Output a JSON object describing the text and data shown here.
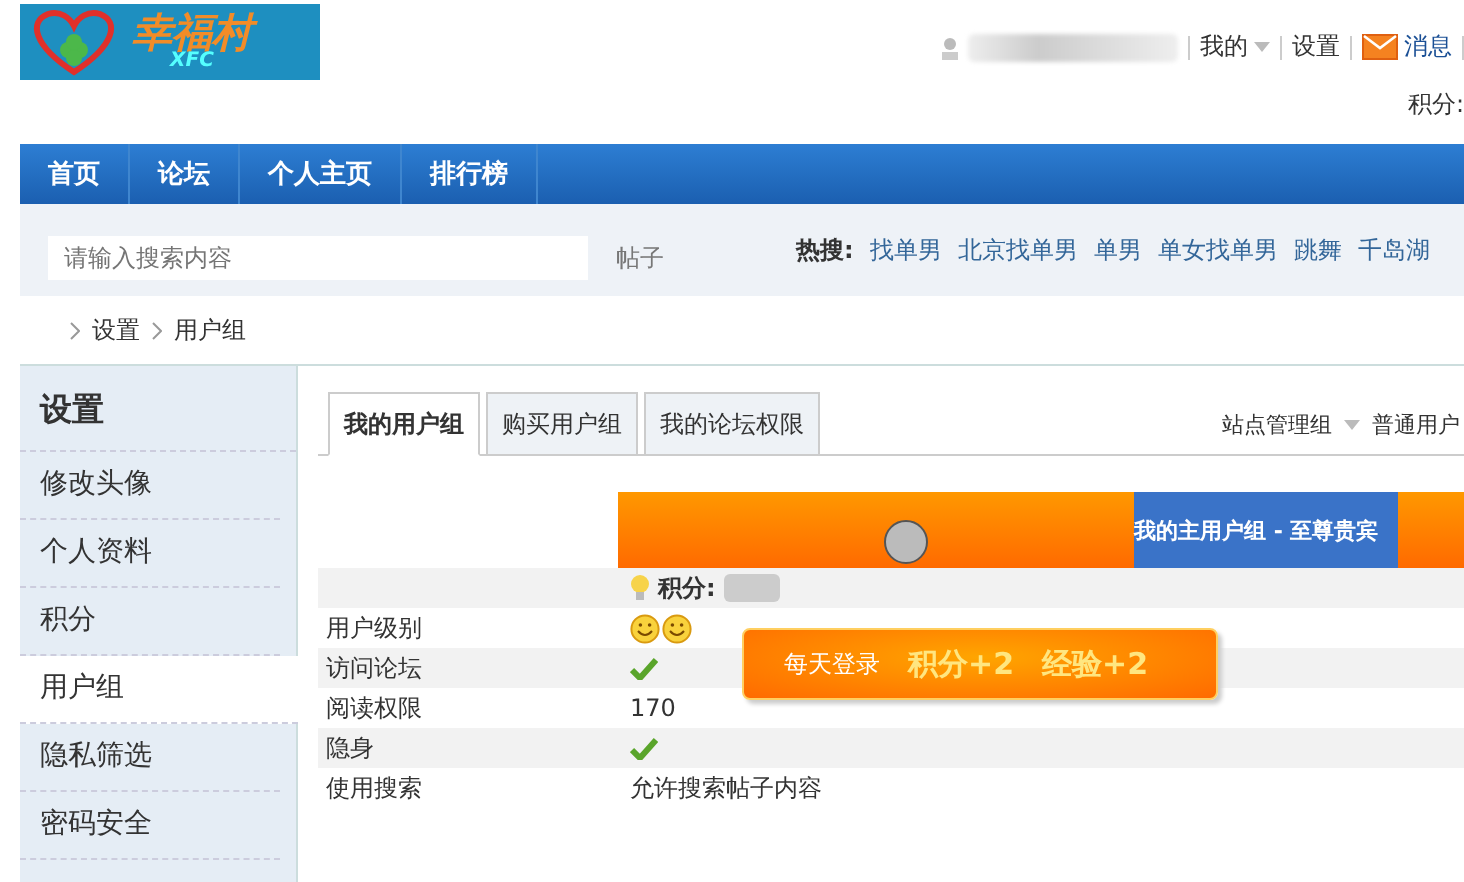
{
  "logo": {
    "title": "幸福村",
    "subtitle": "XFC"
  },
  "user_bar": {
    "items": [
      {
        "label": "我的",
        "kind": "dropdown"
      },
      {
        "label": "设置",
        "kind": "link"
      },
      {
        "label": "消息",
        "kind": "mail"
      }
    ],
    "points_label": "积分:"
  },
  "nav": [
    {
      "label": "首页"
    },
    {
      "label": "论坛"
    },
    {
      "label": "个人主页"
    },
    {
      "label": "排行榜"
    }
  ],
  "search": {
    "placeholder": "请输入搜索内容",
    "scope": "帖子",
    "hot_label": "热搜:",
    "hot": [
      "找单男",
      "北京找单男",
      "单男",
      "单女找单男",
      "跳舞",
      "千岛湖"
    ]
  },
  "breadcrumb": [
    "设置",
    "用户组"
  ],
  "sidebar": {
    "title": "设置",
    "items": [
      {
        "label": "修改头像",
        "selected": false
      },
      {
        "label": "个人资料",
        "selected": false
      },
      {
        "label": "积分",
        "selected": false
      },
      {
        "label": "用户组",
        "selected": true
      },
      {
        "label": "隐私筛选",
        "selected": false
      },
      {
        "label": "密码安全",
        "selected": false
      }
    ]
  },
  "tabs": [
    {
      "label": "我的用户组",
      "selected": true
    },
    {
      "label": "购买用户组",
      "selected": false
    },
    {
      "label": "我的论坛权限",
      "selected": false
    }
  ],
  "group_selectors": [
    "站点管理组",
    "普通用户"
  ],
  "group_header": {
    "main_group": "我的主用户组 - 至尊贵宾",
    "points_label": "积分:"
  },
  "rows": [
    {
      "label": "用户级别",
      "kind": "smileys",
      "value": ""
    },
    {
      "label": "访问论坛",
      "kind": "check",
      "value": ""
    },
    {
      "label": "阅读权限",
      "kind": "text",
      "value": "170"
    },
    {
      "label": "隐身",
      "kind": "check",
      "value": ""
    },
    {
      "label": "使用搜索",
      "kind": "text",
      "value": "允许搜索帖子内容"
    }
  ],
  "popup": {
    "prefix": "每天登录",
    "rewards": [
      "积分+2",
      "经验+2"
    ]
  }
}
